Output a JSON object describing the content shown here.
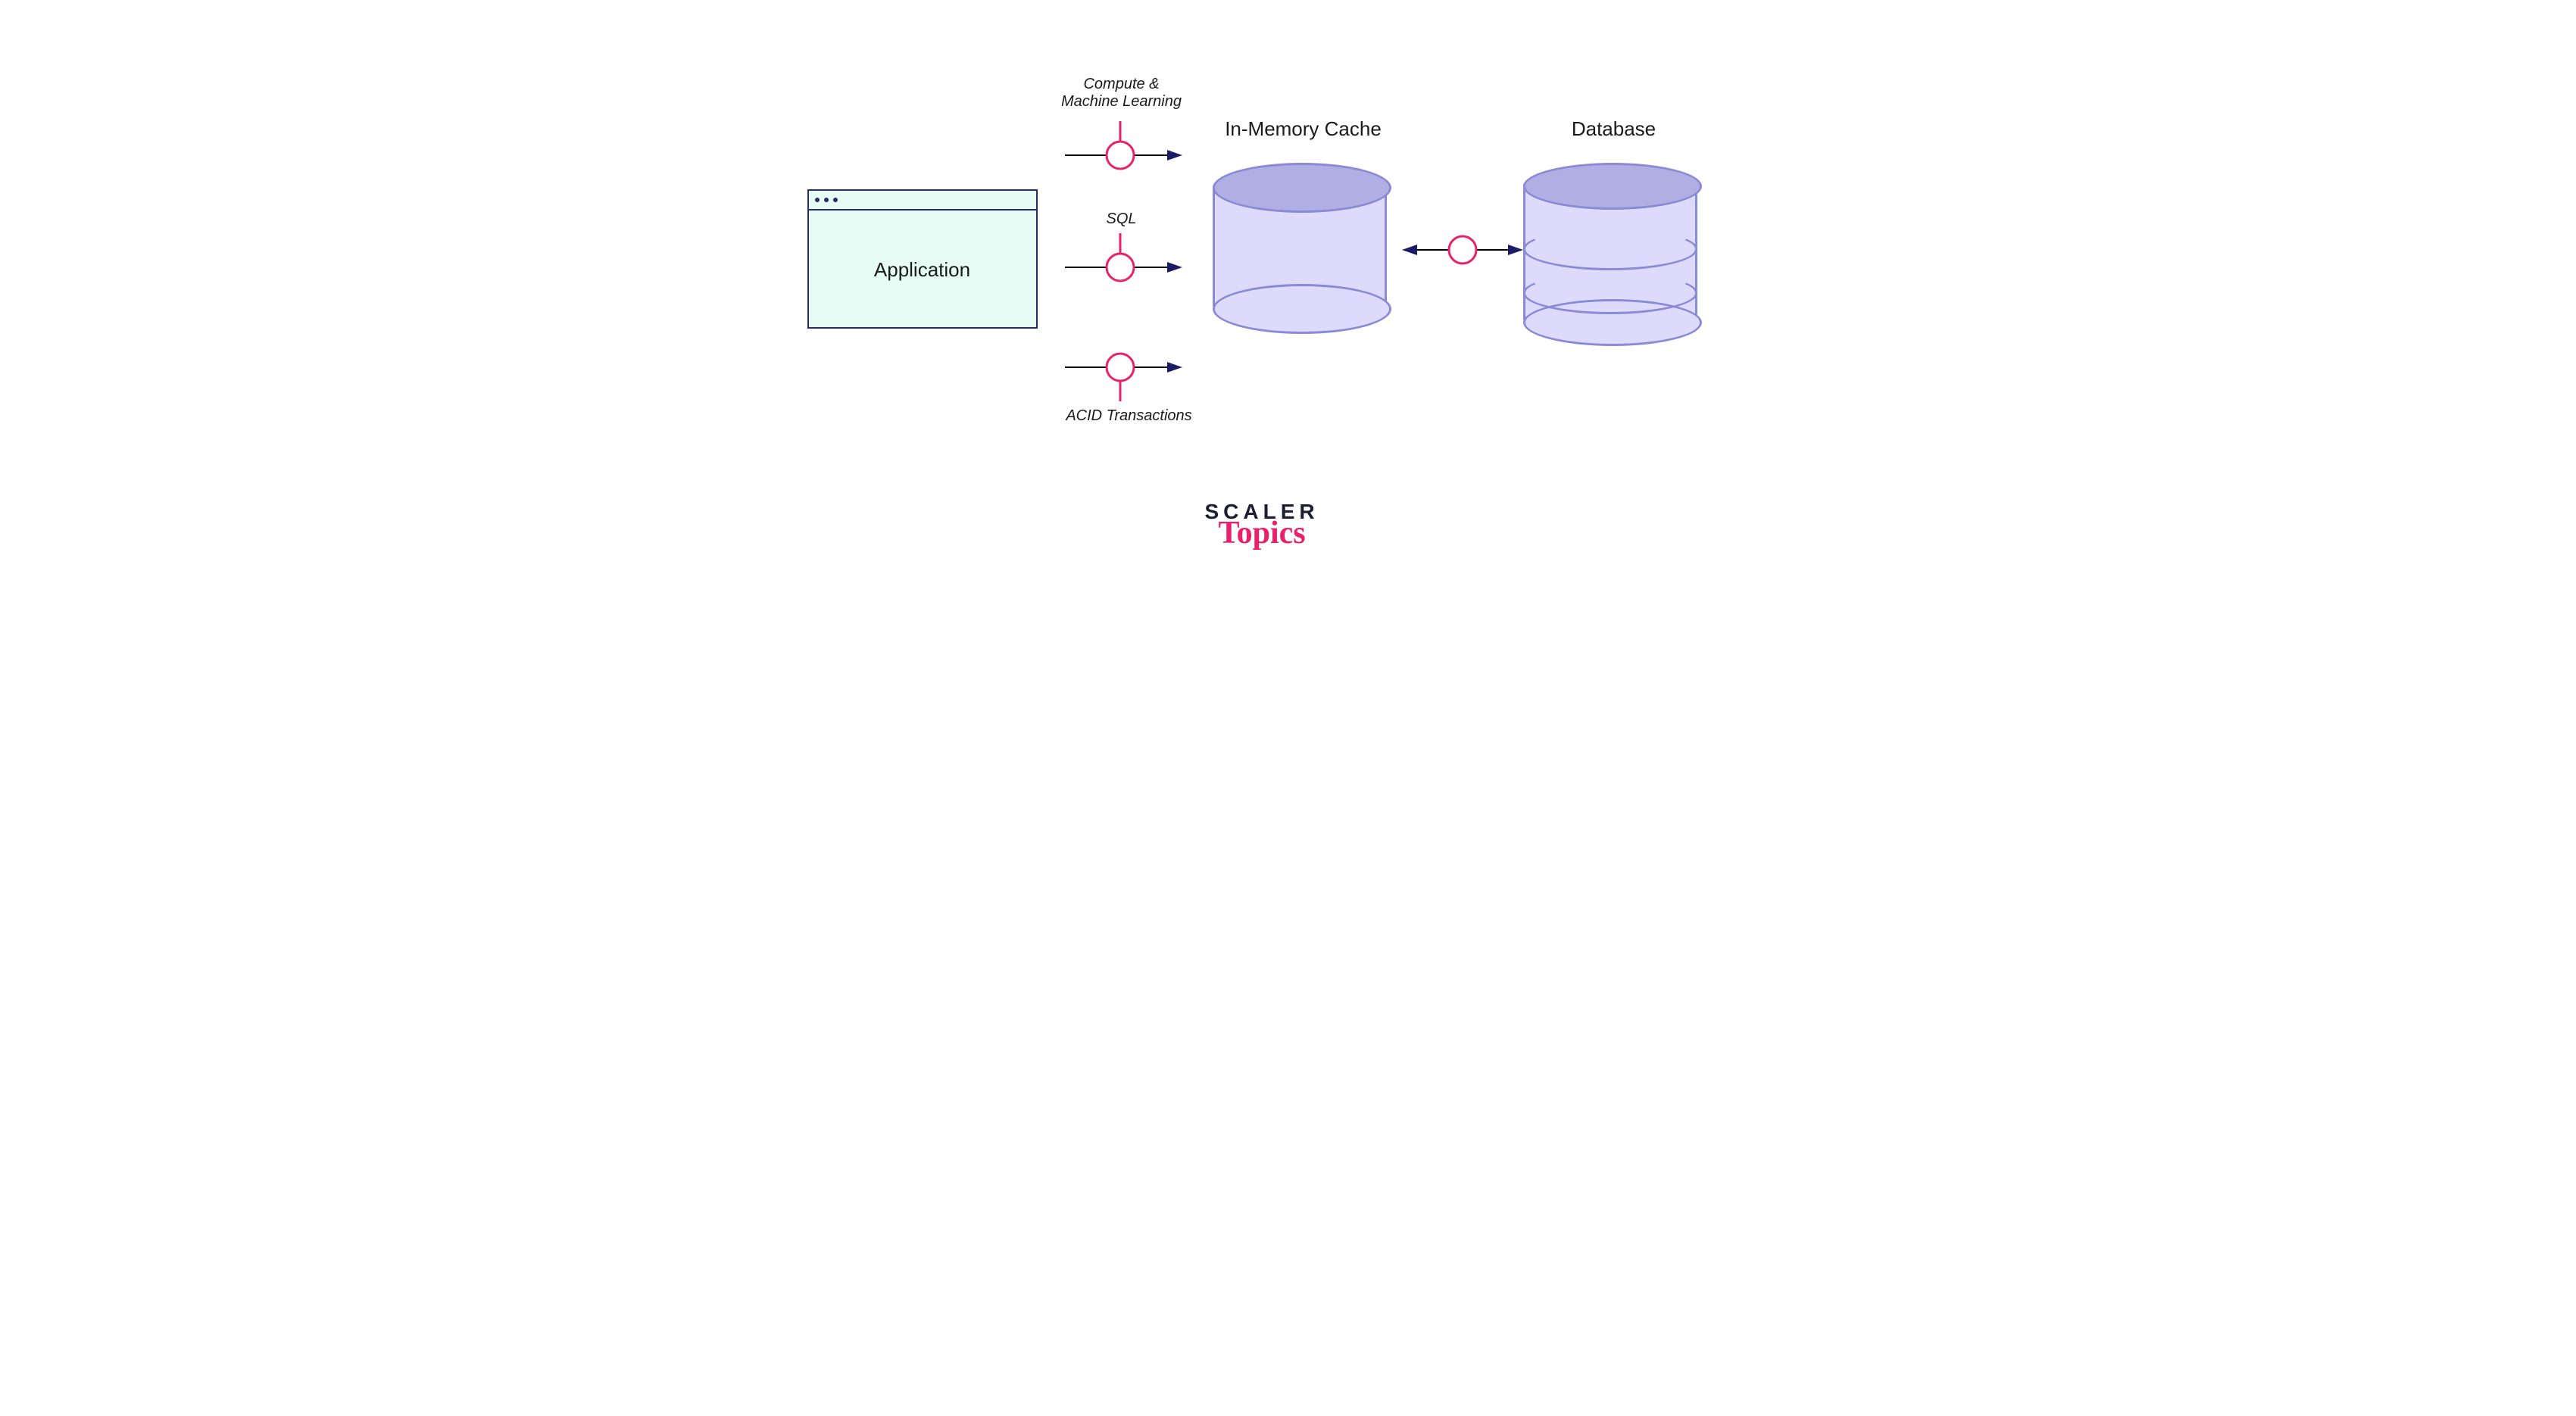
{
  "diagram": {
    "application": {
      "label": "Application"
    },
    "cache": {
      "label": "In-Memory Cache"
    },
    "database": {
      "label": "Database"
    },
    "connectors": {
      "top": {
        "label_line1": "Compute &",
        "label_line2": "Machine Learning"
      },
      "middle": {
        "label": "SQL"
      },
      "bottom": {
        "label": "ACID Transactions"
      }
    },
    "logo": {
      "brand": "SCALER",
      "sub": "Topics"
    }
  }
}
